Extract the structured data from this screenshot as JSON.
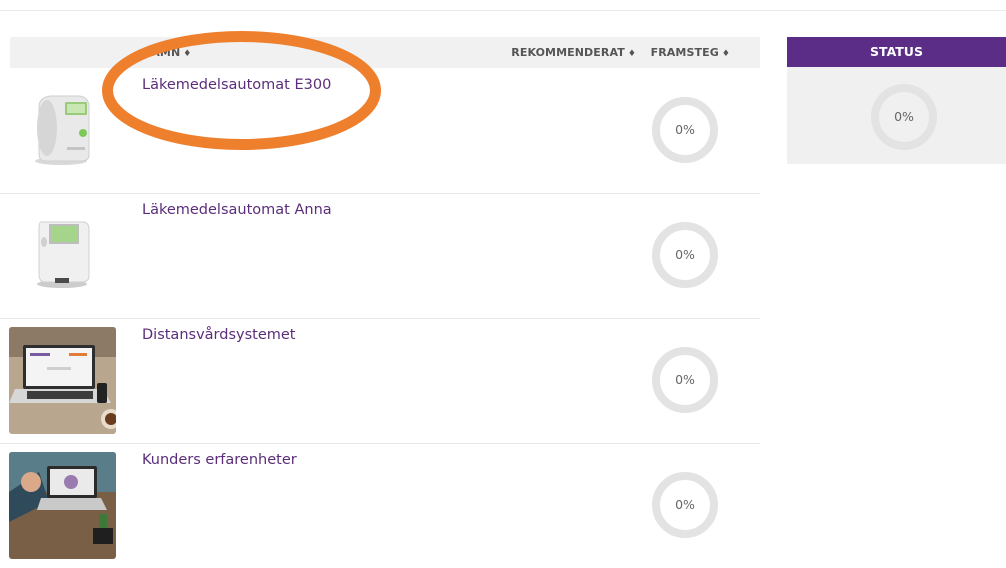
{
  "table": {
    "headers": {
      "name": "NAMN",
      "recommended": "REKOMMENDERAT",
      "progress": "FRAMSTEG",
      "sort_glyph": "♦"
    },
    "rows": [
      {
        "title": "Läkemedelsautomat E300",
        "progress_value": 0,
        "progress_label": "0%",
        "thumb_icon": "dispenser-e300-image"
      },
      {
        "title": "Läkemedelsautomat Anna",
        "progress_value": 0,
        "progress_label": "0%",
        "thumb_icon": "dispenser-anna-image"
      },
      {
        "title": "Distansvårdsystemet",
        "progress_value": 0,
        "progress_label": "0%",
        "thumb_icon": "laptop-desk-image"
      },
      {
        "title": "Kunders erfarenheter",
        "progress_value": 0,
        "progress_label": "0%",
        "thumb_icon": "laptop-user-image"
      }
    ]
  },
  "status": {
    "label": "STATUS",
    "progress_value": 0,
    "progress_label": "0%"
  },
  "colors": {
    "title_purple": "#5b2d7a",
    "status_header": "#5b2d87",
    "annotation_orange": "#ee7f2d",
    "ring_gray": "#e3e3e3"
  }
}
